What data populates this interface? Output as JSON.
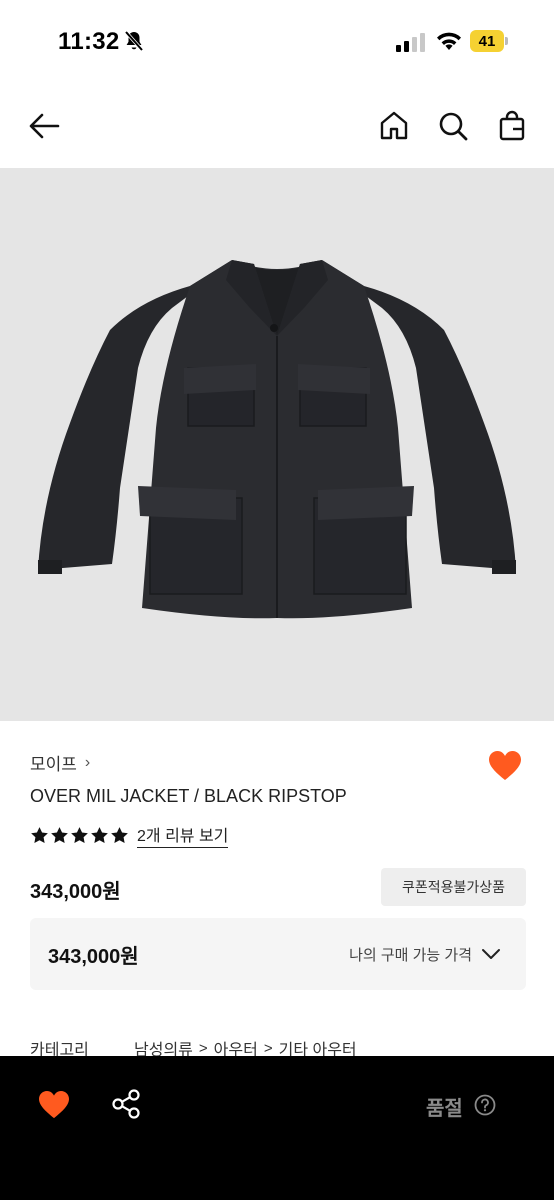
{
  "status_bar": {
    "time": "11:32",
    "battery": "41"
  },
  "colors": {
    "accent_heart": "#ff5a1f",
    "battery": "#f5d132",
    "image_bg": "#e5e5e5"
  },
  "icons": {
    "nav": [
      "back-arrow-icon",
      "home-icon",
      "search-icon",
      "shopping-bag-icon"
    ],
    "bottom": [
      "heart-icon",
      "share-icon",
      "help-icon"
    ]
  },
  "product": {
    "brand": "모이프",
    "title": "OVER MIL JACKET / BLACK RIPSTOP",
    "rating": 5,
    "review_link": "2개 리뷰 보기",
    "price": "343,000원",
    "coupon_badge": "쿠폰적용불가상품",
    "my_price_value": "343,000원",
    "my_price_label": "나의 구매 가능 가격"
  },
  "category": {
    "label": "카테고리",
    "path": [
      "남성의류",
      "아우터",
      "기타 아우터"
    ]
  },
  "bottom_bar": {
    "status": "품절"
  }
}
